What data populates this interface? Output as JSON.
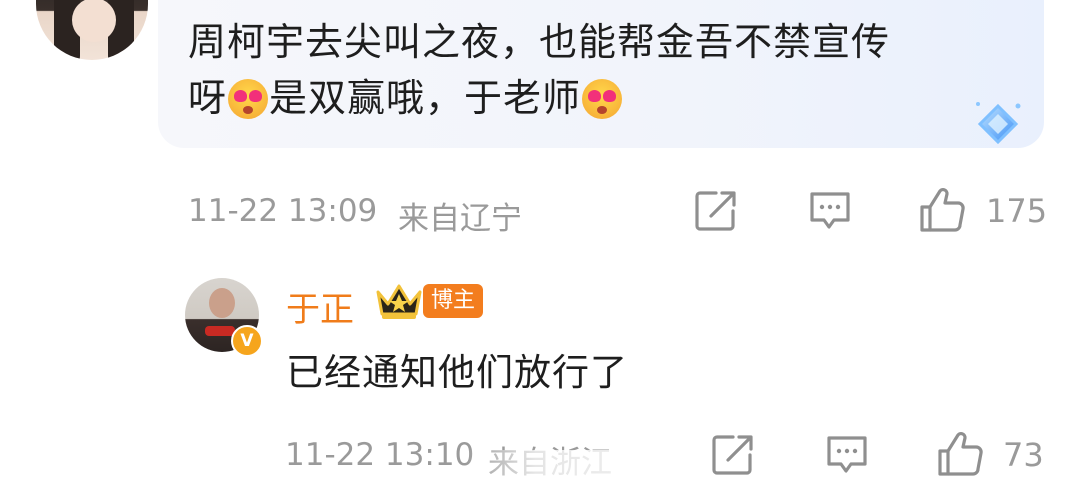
{
  "comment": {
    "text_line1": "周柯宇去尖叫之夜，也能帮金吾不禁宣传",
    "text_line2_a": "呀",
    "text_line2_b": "是双赢哦，于老师",
    "emoji_1": "heart-eyes-emoji",
    "emoji_2": "heart-eyes-emoji",
    "time": "11-22 13:09",
    "location": "来自辽宁",
    "like_count": "175"
  },
  "reply": {
    "username": "于正",
    "badge": "博主",
    "verified_badge": "V",
    "text": "已经通知他们放行了",
    "time": "11-22 13:10",
    "location": "来自浙江",
    "like_count": "73"
  },
  "icons": {
    "share": "share-icon",
    "comment": "comment-icon",
    "like": "thumbs-up-icon",
    "crown": "crown-icon",
    "diamond": "diamond-badge-icon"
  },
  "colors": {
    "username": "#f07c1a",
    "badge_bg": "#f37d1e",
    "meta_text": "#9a9a9a",
    "bubble_bg": "#f2f5fc"
  }
}
